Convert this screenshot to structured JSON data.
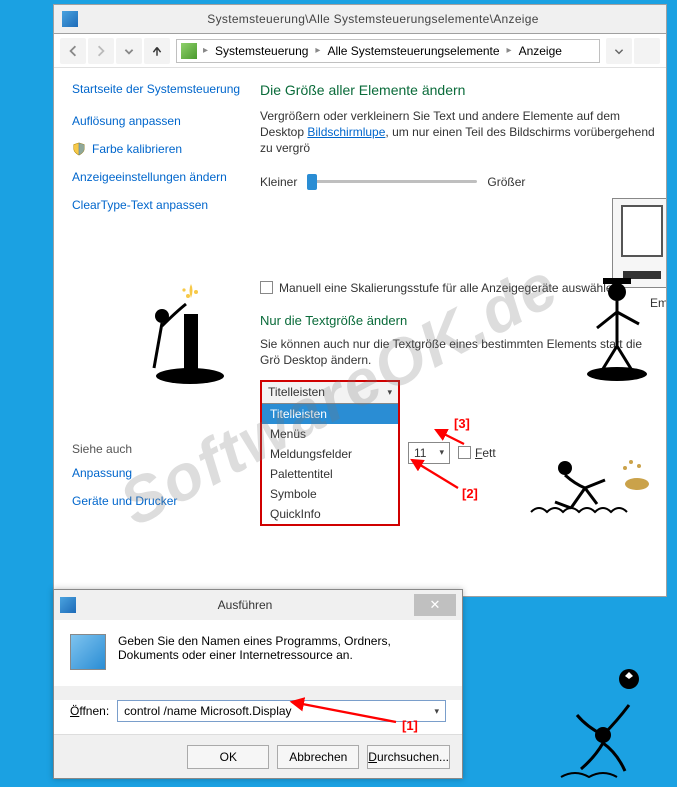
{
  "titlebar": "Systemsteuerung\\Alle Systemsteuerungselemente\\Anzeige",
  "breadcrumb": {
    "items": [
      "Systemsteuerung",
      "Alle Systemsteuerungselemente",
      "Anzeige"
    ]
  },
  "sidebar": {
    "home": "Startseite der Systemsteuerung",
    "links": [
      "Auflösung anpassen",
      "Farbe kalibrieren",
      "Anzeigeeinstellungen ändern",
      "ClearType-Text anpassen"
    ],
    "seeAlsoTitle": "Siehe auch",
    "seeAlso": [
      "Anpassung",
      "Geräte und Drucker"
    ]
  },
  "main": {
    "heading1": "Die Größe aller Elemente ändern",
    "para1a": "Vergrößern oder verkleinern Sie Text und andere Elemente auf dem Desktop",
    "magnifier": "Bildschirmlupe",
    "para1b": ", um nur einen Teil des Bildschirms vorübergehend zu vergrö",
    "sliderSmall": "Kleiner",
    "sliderLarge": "Größer",
    "previewLabel": "Em",
    "manualScale": "Manuell eine Skalierungsstufe für alle Anzeigegeräte auswählen",
    "heading2": "Nur die Textgröße ändern",
    "para2": "Sie können auch nur die Textgröße eines bestimmten Elements statt die Grö Desktop ändern.",
    "dropdown": {
      "selected": "Titelleisten",
      "options": [
        "Titelleisten",
        "Menüs",
        "Meldungsfelder",
        "Palettentitel",
        "Symbole",
        "QuickInfo"
      ]
    },
    "sizeSelected": "11",
    "boldLabel": "Fett"
  },
  "annotations": {
    "a1": "[1]",
    "a2": "[2]",
    "a3": "[3]"
  },
  "run": {
    "title": "Ausführen",
    "desc": "Geben Sie den Namen eines Programms, Ordners, Dokuments oder einer Internetressource an.",
    "openLabel": "Öffnen:",
    "openValue": "control /name Microsoft.Display",
    "ok": "OK",
    "cancel": "Abbrechen",
    "browse": "Durchsuchen..."
  },
  "watermark": "SoftwareOK.de"
}
